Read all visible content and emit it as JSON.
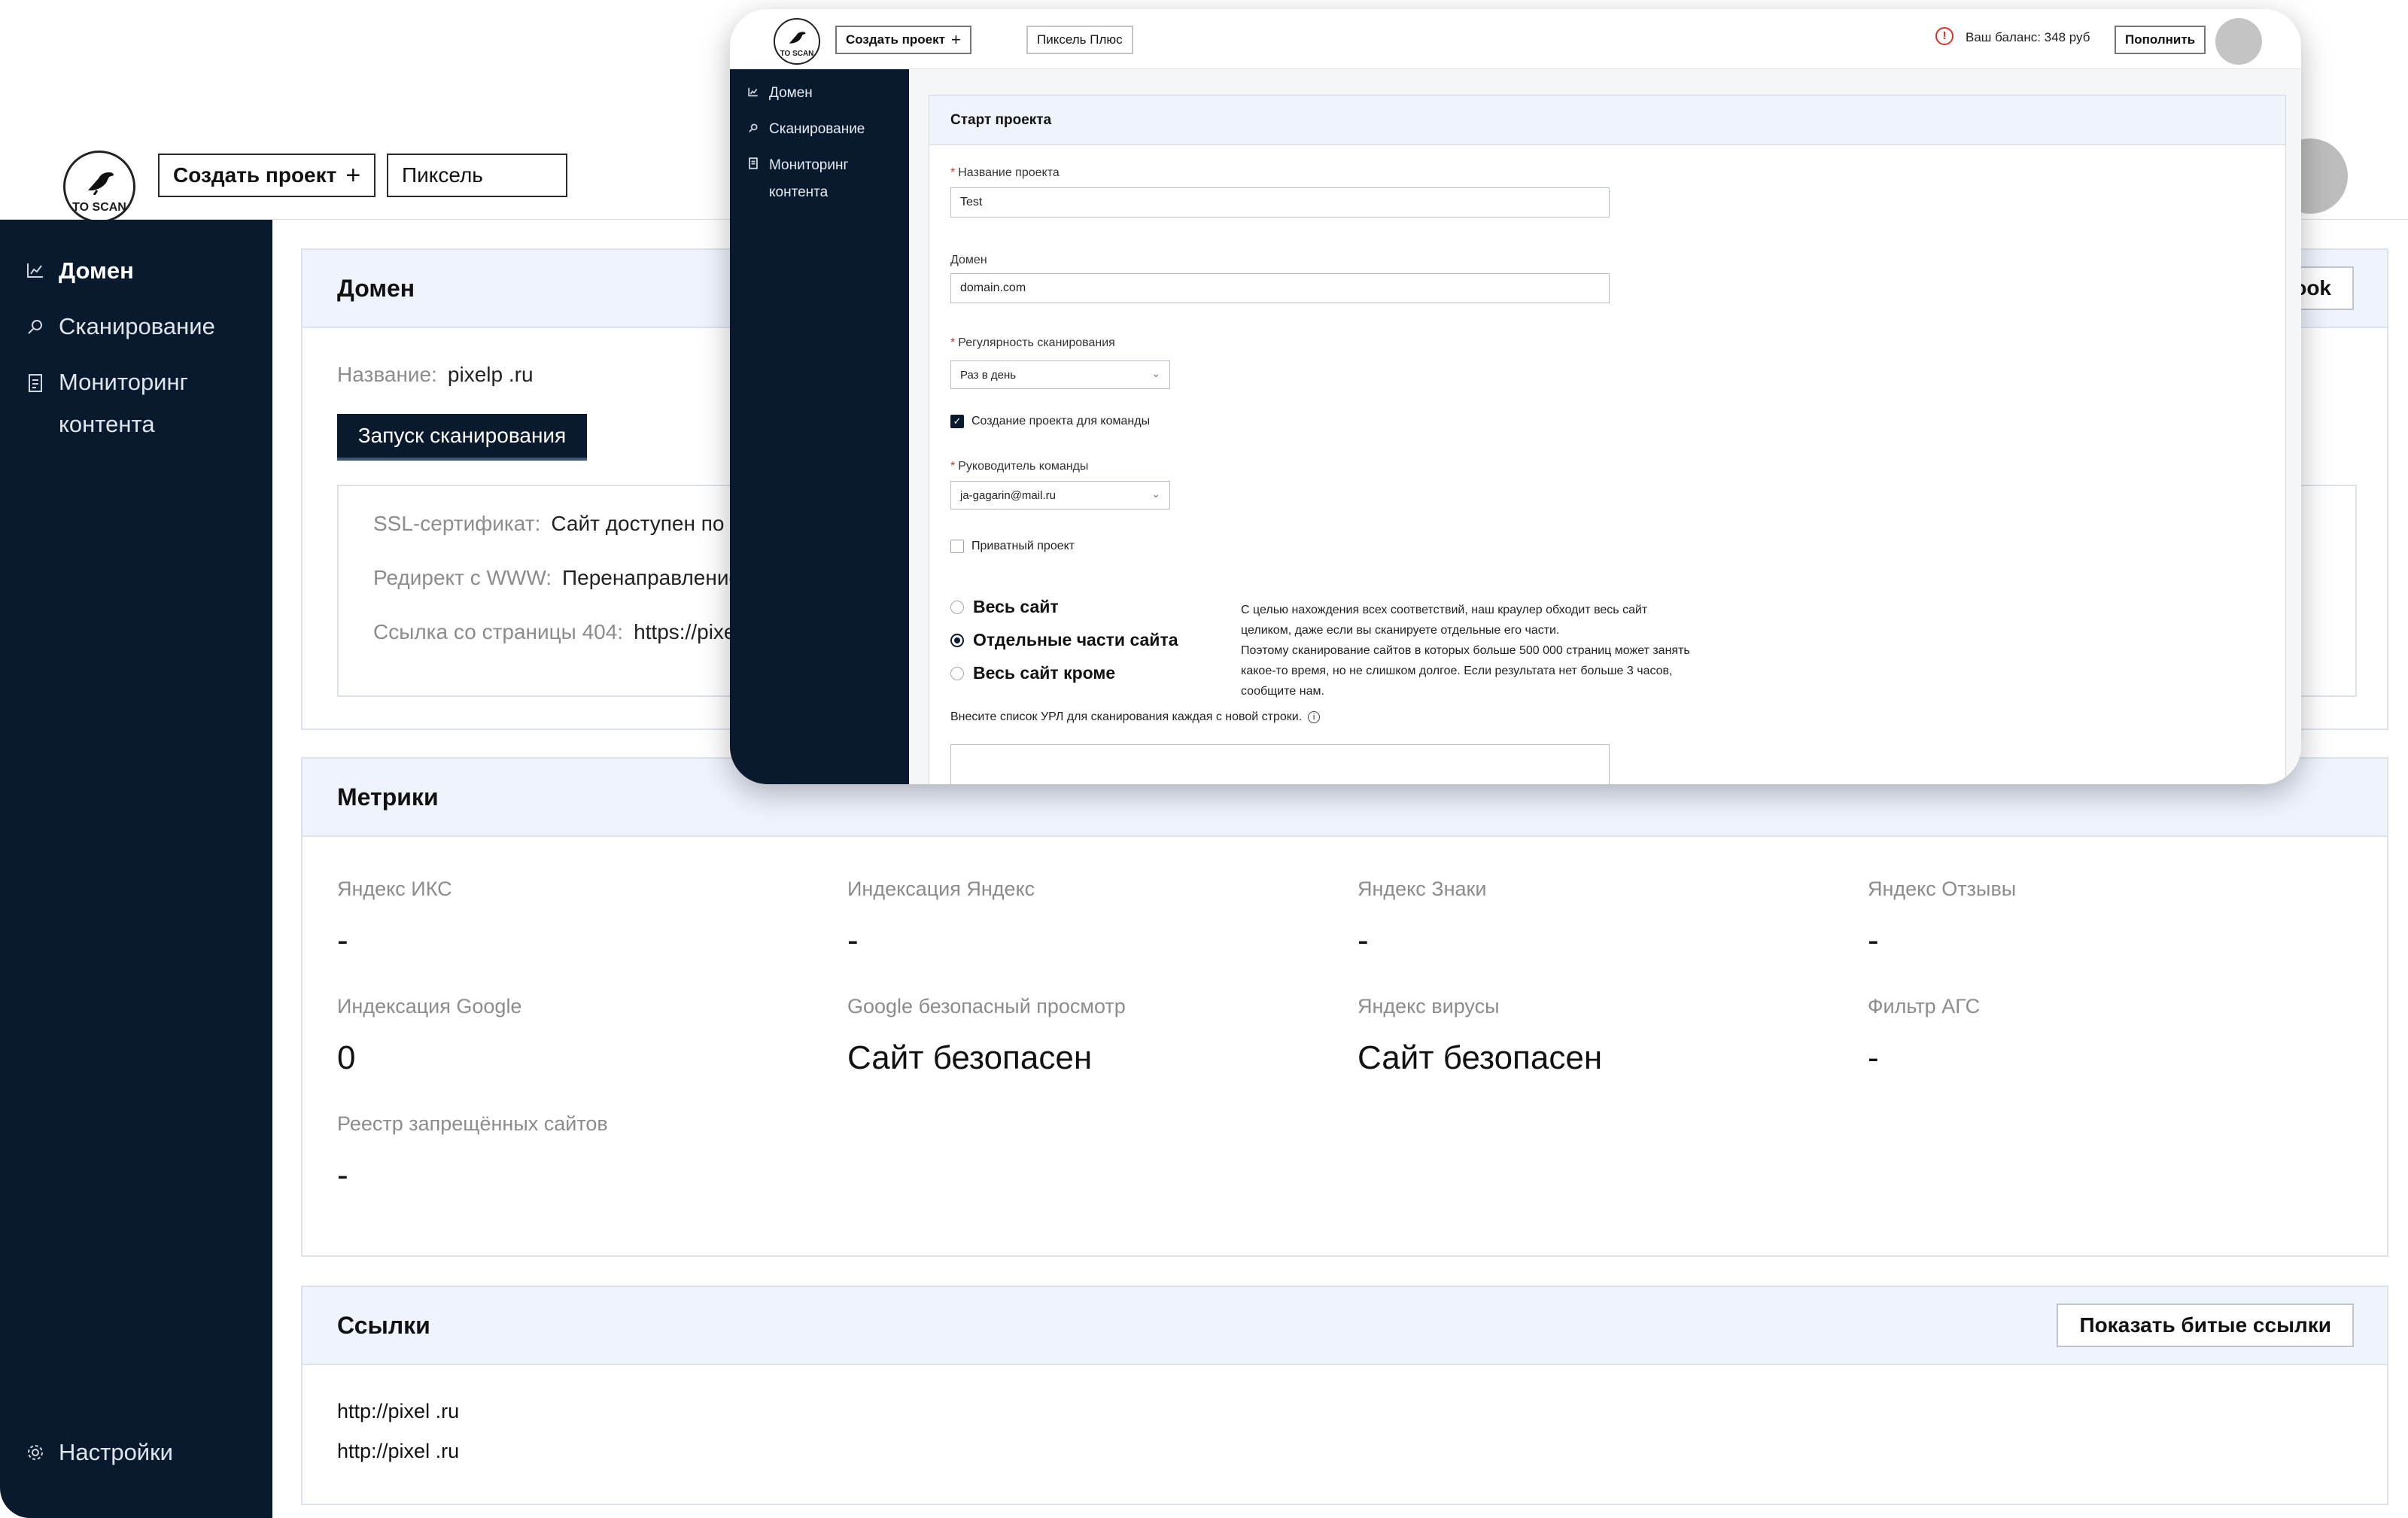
{
  "back": {
    "logo_text": "TO SCAN",
    "header": {
      "create_project": "Создать проект",
      "create_icon": "+",
      "project_switch": "Пиксель"
    },
    "sidebar": {
      "items": [
        {
          "icon": "chart-icon",
          "label": "Домен"
        },
        {
          "icon": "search-icon",
          "label": "Сканирование"
        },
        {
          "icon": "document-icon",
          "label": "Мониторинг контента"
        }
      ],
      "settings": {
        "icon": "gear-icon",
        "label": "Настройки"
      }
    },
    "domain_panel": {
      "title": "Домен",
      "right_button_partial": "ook",
      "name_label": "Название:",
      "name_value": "pixelp .ru",
      "scan_button": "Запуск сканирования",
      "ssl_label": "SSL-сертификат:",
      "ssl_value": "Сайт доступен по H",
      "www_label": "Редирект с WWW:",
      "www_value": "Перенаправление",
      "p404_label": "Ссылка со страницы 404:",
      "p404_value": "https://pixe"
    },
    "metrics": {
      "title": "Метрики",
      "items": [
        {
          "label": "Яндекс ИКС",
          "value": "-"
        },
        {
          "label": "Индексация Яндекс",
          "value": "-"
        },
        {
          "label": "Яндекс Знаки",
          "value": "-"
        },
        {
          "label": "Яндекс Отзывы",
          "value": "-"
        },
        {
          "label": "Индексация Google",
          "value": "0"
        },
        {
          "label": "Google безопасный просмотр",
          "value": "Сайт безопасен"
        },
        {
          "label": "Яндекс вирусы",
          "value": "Сайт безопасен"
        },
        {
          "label": "Фильтр АГС",
          "value": "-"
        },
        {
          "label": "Реестр запрещённых сайтов",
          "value": "-"
        }
      ]
    },
    "links": {
      "title": "Ссылки",
      "button": "Показать битые ссылки",
      "items": [
        "http://pixel .ru",
        "http://pixel .ru"
      ]
    }
  },
  "front": {
    "logo_text": "TO SCAN",
    "header": {
      "create_project": "Создать проект",
      "create_icon": "+",
      "project_switch": "Пиксель Плюс",
      "warning_icon": "!",
      "balance": "Ваш баланс: 348 руб",
      "topup": "Пополнить"
    },
    "sidebar": {
      "items": [
        {
          "icon": "chart-icon",
          "label": "Домен"
        },
        {
          "icon": "search-icon",
          "label": "Сканирование"
        },
        {
          "icon": "document-icon",
          "label": "Мониторинг контента"
        }
      ]
    },
    "form": {
      "title": "Старт проекта",
      "required_mark": "*",
      "name_label": "Название проекта",
      "name_value": "Test",
      "domain_label": "Домен",
      "domain_value": "domain.com",
      "frequency_label": "Регулярность сканирования",
      "frequency_value": "Раз в день",
      "team_checkbox": "Создание проекта для команды",
      "team_checked": true,
      "leader_label": "Руководитель команды",
      "leader_value": "ja-gagarin@mail.ru",
      "private_checkbox": "Приватный проект",
      "private_checked": false,
      "scope_options": [
        "Весь сайт",
        "Отдельные части сайта",
        "Весь сайт кроме"
      ],
      "scope_selected": "Отдельные части сайта",
      "note_lines": [
        "С целью нахождения всех соответствий, наш краулер обходит весь сайт",
        "целиком, даже если вы сканируете отдельные его части.",
        "Поэтому сканирование сайтов в которых больше 500 000 страниц может занять",
        "какое-то время, но не слишком долгое. Если результата нет больше 3 часов,",
        "сообщите нам."
      ],
      "url_list_label": "Внесите список УРЛ для сканирования каждая с новой строки.",
      "url_list_value": ""
    }
  },
  "colors": {
    "sidebar": "#0a1a2e",
    "panel_header": "#eef3fc",
    "warning": "#d93025"
  }
}
